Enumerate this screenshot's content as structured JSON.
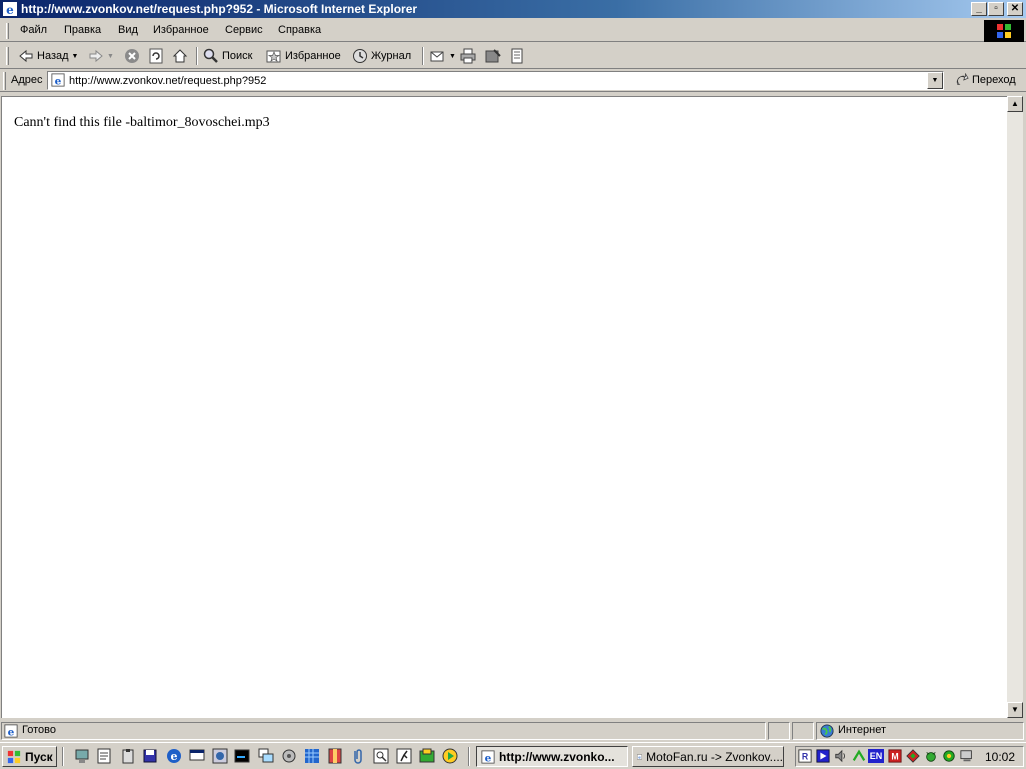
{
  "window": {
    "title": "http://www.zvonkov.net/request.php?952 - Microsoft Internet Explorer",
    "minimize_glyph": "_",
    "maximize_glyph": "▫",
    "close_glyph": "✕"
  },
  "menu": {
    "items": [
      "Файл",
      "Правка",
      "Вид",
      "Избранное",
      "Сервис",
      "Справка"
    ]
  },
  "toolbar": {
    "back_label": "Назад",
    "search_label": "Поиск",
    "favorites_label": "Избранное",
    "history_label": "Журнал"
  },
  "address": {
    "label": "Адрес",
    "value": "http://www.zvonkov.net/request.php?952",
    "go_label": "Переход"
  },
  "content": {
    "message": "Cann't find this file -baltimor_8ovoschei.mp3"
  },
  "status": {
    "text": "Готово",
    "zone": "Интернет"
  },
  "taskbar": {
    "start_label": "Пуск",
    "tasks": [
      {
        "label": "http://www.zvonko...",
        "active": true
      },
      {
        "label": "MotoFan.ru -> Zvonkov....",
        "active": false
      }
    ],
    "tray_lang": "EN",
    "clock": "10:02"
  },
  "colors": {
    "titlebar_start": "#0a246a",
    "titlebar_end": "#a6caf0",
    "chrome": "#d4d0c8"
  }
}
